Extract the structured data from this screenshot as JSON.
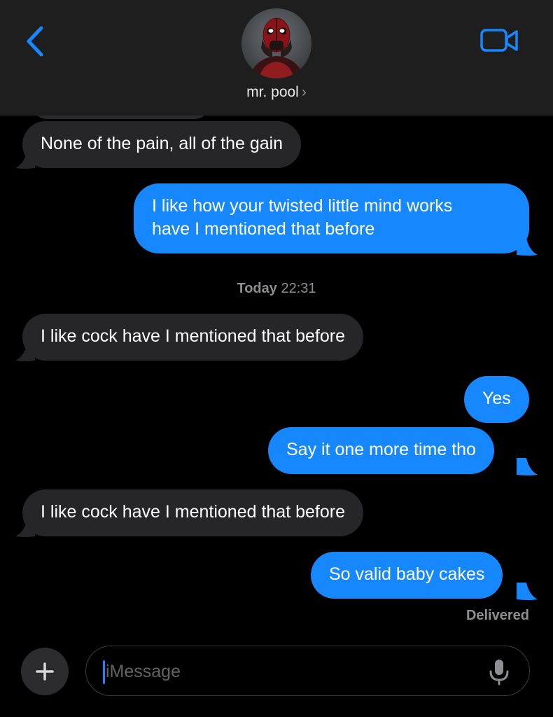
{
  "header": {
    "contact_name": "mr. pool",
    "chevron": "›",
    "back_icon": "chevron-left-icon",
    "video_icon": "video-camera-icon",
    "accent_color": "#1787fe"
  },
  "messages": [
    {
      "direction": "incoming",
      "text": "None of the pain, all of the gain"
    },
    {
      "direction": "outgoing",
      "lines": [
        "I like how your twisted little mind works",
        "have I mentioned that before"
      ]
    },
    {
      "direction": "incoming",
      "text": "I like cock have I mentioned that before"
    },
    {
      "direction": "outgoing",
      "text": "Yes"
    },
    {
      "direction": "outgoing",
      "text": "Say it one more time tho"
    },
    {
      "direction": "incoming",
      "text": "I like cock have I mentioned that before"
    },
    {
      "direction": "outgoing",
      "text": "So valid baby cakes"
    }
  ],
  "timestamp": {
    "day": "Today",
    "time": "22:31"
  },
  "status": "Delivered",
  "composer": {
    "placeholder": "iMessage",
    "plus_icon": "plus-icon",
    "mic_icon": "microphone-icon"
  },
  "colors": {
    "incoming_bubble": "#262628",
    "outgoing_bubble": "#1787fe",
    "header_bg": "#1e1e1e"
  }
}
